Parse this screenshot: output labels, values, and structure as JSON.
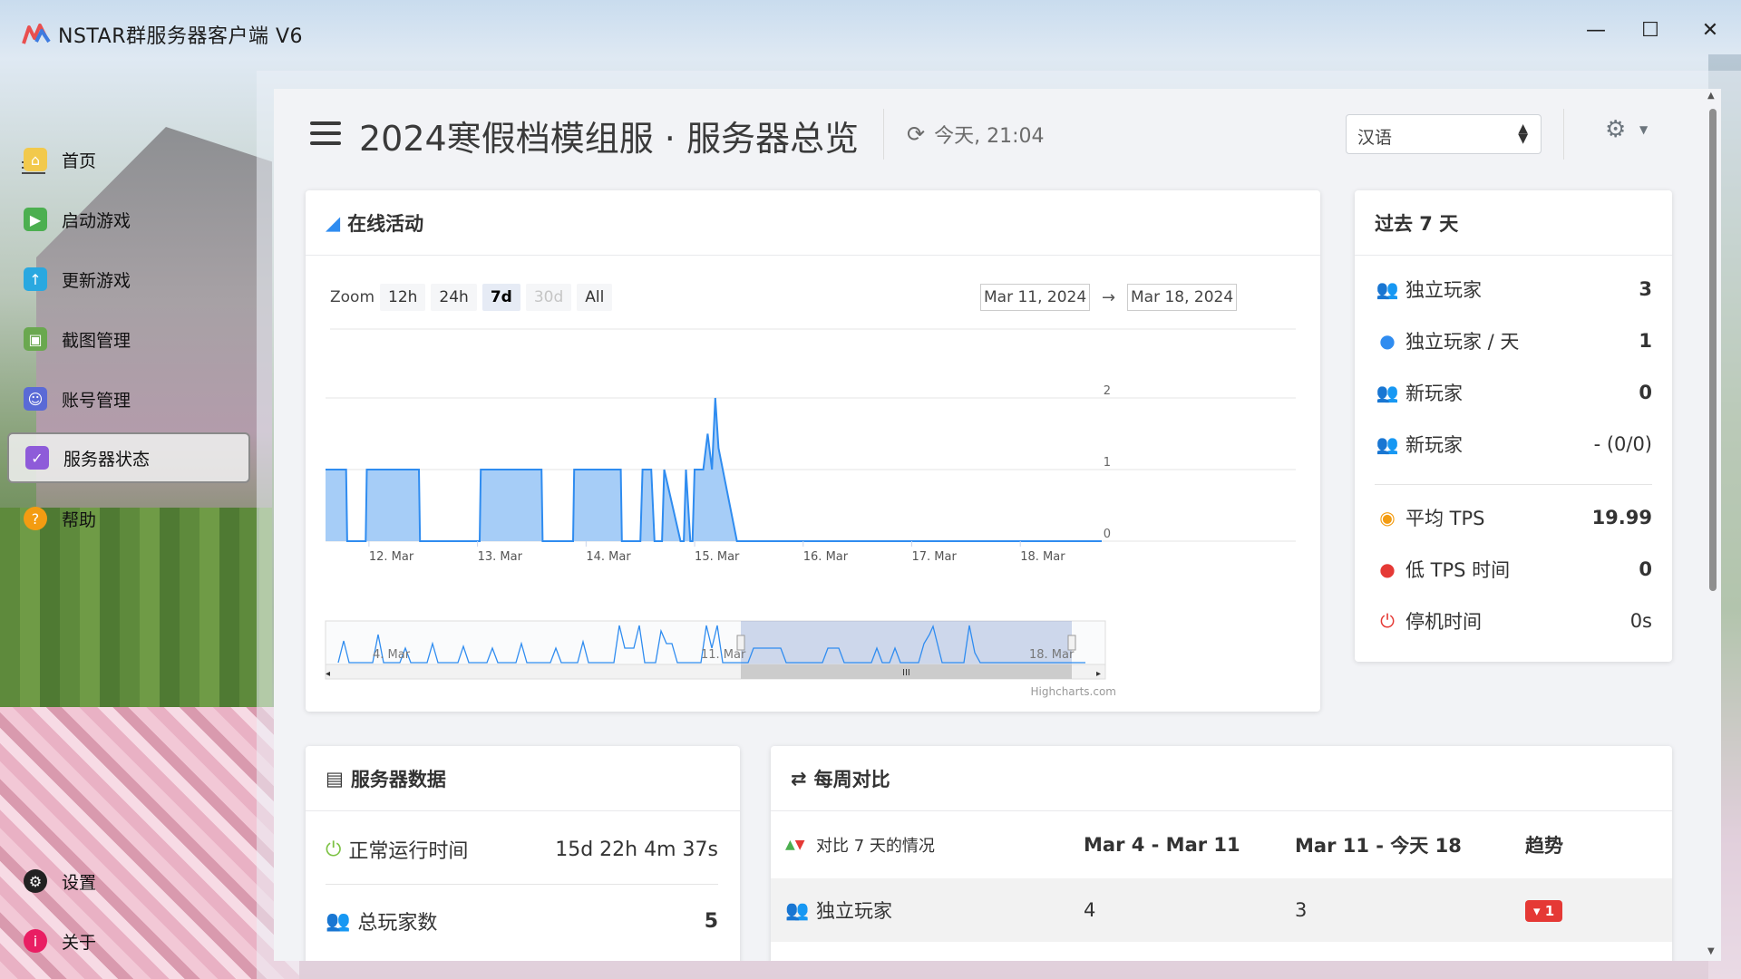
{
  "window": {
    "title": "NSTAR群服务器客户端 V6",
    "controls": [
      "—",
      "☐",
      "✕"
    ]
  },
  "sidebar": {
    "items": [
      {
        "label": "首页",
        "icon": "home-icon",
        "color": "#f2c94c"
      },
      {
        "label": "启动游戏",
        "icon": "play-icon",
        "color": "#4caf50"
      },
      {
        "label": "更新游戏",
        "icon": "upload-icon",
        "color": "#29a8e0"
      },
      {
        "label": "截图管理",
        "icon": "image-icon",
        "color": "#6aa84f"
      },
      {
        "label": "账号管理",
        "icon": "account-icon",
        "color": "#5a6ad6"
      },
      {
        "label": "服务器状态",
        "icon": "shield-check-icon",
        "color": "#8e5bd9",
        "active": true
      },
      {
        "label": "帮助",
        "icon": "help-icon",
        "color": "#f39c12"
      }
    ],
    "bottom": [
      {
        "label": "设置",
        "icon": "gear-icon"
      },
      {
        "label": "关于",
        "icon": "info-icon"
      }
    ]
  },
  "header": {
    "title": "2024寒假档模组服 · 服务器总览",
    "refresh": "今天, 21:04",
    "language": "汉语"
  },
  "online_activity": {
    "title": "在线活动",
    "zoom_label": "Zoom",
    "zoom_buttons": [
      "12h",
      "24h",
      "7d",
      "30d",
      "All"
    ],
    "zoom_selected": "7d",
    "zoom_disabled": "30d",
    "range_from": "Mar 11, 2024",
    "range_to": "Mar 18, 2024",
    "arrow": "→",
    "credit": "Highcharts.com",
    "navigator_labels": [
      "4. Mar",
      "11. Mar",
      "18. Mar"
    ]
  },
  "chart_data": {
    "type": "area",
    "title": "",
    "xlabel": "",
    "ylabel": "",
    "ylim": [
      0,
      2
    ],
    "yticks": [
      0,
      1,
      2
    ],
    "xticks": [
      "12. Mar",
      "13. Mar",
      "14. Mar",
      "15. Mar",
      "16. Mar",
      "17. Mar",
      "18. Mar"
    ],
    "x_range_days": [
      11.6,
      18.75
    ],
    "color": "#2f8cf0",
    "fill": "#a6cdf7",
    "series": [
      {
        "x": [
          11.6,
          11.79,
          11.8,
          11.97,
          11.98,
          12.46,
          12.47,
          13.02,
          13.03,
          13.59,
          13.6,
          13.88,
          13.89,
          14.32,
          14.33,
          14.5,
          14.52,
          14.6,
          14.63,
          14.7,
          14.72,
          14.87,
          14.9,
          14.92,
          14.96,
          14.98,
          15.0,
          15.04,
          15.08,
          15.12,
          15.16,
          15.19,
          15.22,
          15.39,
          15.4,
          15.64,
          15.67,
          15.69,
          15.72,
          15.74,
          15.76,
          15.79,
          15.82,
          15.86,
          16.1,
          16.12,
          16.18,
          16.22,
          16.3,
          16.35,
          16.37,
          16.4,
          16.43,
          16.45,
          16.49,
          16.5,
          18.75
        ],
        "y": [
          1,
          1,
          0,
          0,
          1,
          1,
          0,
          0,
          1,
          1,
          0,
          0,
          1,
          1,
          0,
          0,
          1,
          1,
          0,
          0,
          1,
          0,
          0,
          1,
          0,
          0,
          1,
          1,
          1,
          1.5,
          1,
          2,
          1.3,
          0,
          0,
          0,
          0,
          0,
          0,
          0,
          0,
          0,
          0,
          0,
          0,
          0,
          0,
          0,
          0,
          0,
          0,
          0,
          0,
          0,
          0,
          0,
          0
        ]
      }
    ]
  },
  "past7": {
    "title": "过去 7 天",
    "rows": [
      {
        "icon": "users-icon",
        "label": "独立玩家",
        "value": "3",
        "bold": true,
        "color": "#2f8cf0"
      },
      {
        "icon": "user-icon",
        "label": "独立玩家 / 天",
        "value": "1",
        "bold": true,
        "color": "#2f8cf0"
      },
      {
        "icon": "users-green-icon",
        "label": "新玩家",
        "value": "0",
        "bold": true,
        "color": "#7cc243"
      },
      {
        "icon": "users-green-icon",
        "label": "新玩家",
        "value": "- (0/0)",
        "bold": false,
        "color": "#7cc243"
      },
      {
        "icon": "gauge-icon",
        "label": "平均 TPS",
        "value": "19.99",
        "bold": true,
        "color": "#f39c12"
      },
      {
        "icon": "alert-icon",
        "label": "低 TPS 时间",
        "value": "0",
        "bold": true,
        "color": "#e53935"
      },
      {
        "icon": "power-icon",
        "label": "停机时间",
        "value": "0s",
        "bold": false,
        "color": "#e53935"
      }
    ]
  },
  "server_data": {
    "title": "服务器数据",
    "rows": [
      {
        "icon": "power-icon",
        "label": "正常运行时间",
        "value": "15d 22h 4m 37s",
        "color": "#7cc243"
      },
      {
        "icon": "users-icon",
        "label": "总玩家数",
        "value": "5",
        "color": "#555"
      }
    ]
  },
  "weekly": {
    "title": "每周对比",
    "headers": [
      "对比 7 天的情况",
      "Mar 4 - Mar 11",
      "Mar 11 - 今天 18",
      "趋势"
    ],
    "rows": [
      {
        "label": "独立玩家",
        "a": "4",
        "b": "3",
        "trend": "1",
        "trend_dir": "down"
      }
    ]
  }
}
